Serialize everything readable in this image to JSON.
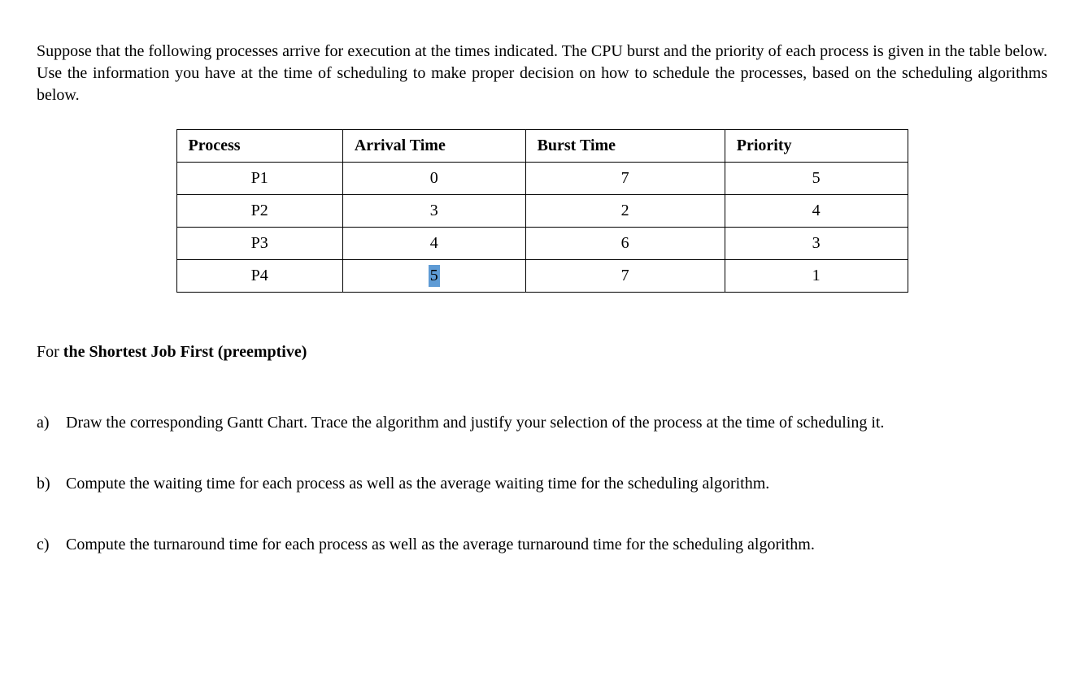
{
  "intro": "Suppose that the following processes arrive for execution at the times indicated. The CPU burst and the priority of each process is given in the table below. Use the information you have at the time of scheduling to make proper decision on how to schedule the processes, based on the scheduling algorithms below.",
  "table": {
    "headers": {
      "process": "Process",
      "arrival": "Arrival Time",
      "burst": "Burst Time",
      "priority": "Priority"
    },
    "rows": [
      {
        "process": "P1",
        "arrival": "0",
        "burst": "7",
        "priority": "5"
      },
      {
        "process": "P2",
        "arrival": "3",
        "burst": "2",
        "priority": "4"
      },
      {
        "process": "P3",
        "arrival": "4",
        "burst": "6",
        "priority": "3"
      },
      {
        "process": "P4",
        "arrival": "5",
        "burst": "7",
        "priority": "1"
      }
    ]
  },
  "section": {
    "prefix": "For ",
    "bold": "the Shortest Job First (preemptive)"
  },
  "questions": {
    "a": {
      "label": "a)",
      "text": "Draw the corresponding Gantt Chart. Trace the algorithm and justify your selection of the process at the time of scheduling it."
    },
    "b": {
      "label": "b)",
      "text": "Compute the waiting time for each process as well as the average waiting time for the scheduling algorithm."
    },
    "c": {
      "label": "c)",
      "text": "Compute the turnaround time for each process as well as the average turnaround time for the scheduling algorithm."
    }
  }
}
